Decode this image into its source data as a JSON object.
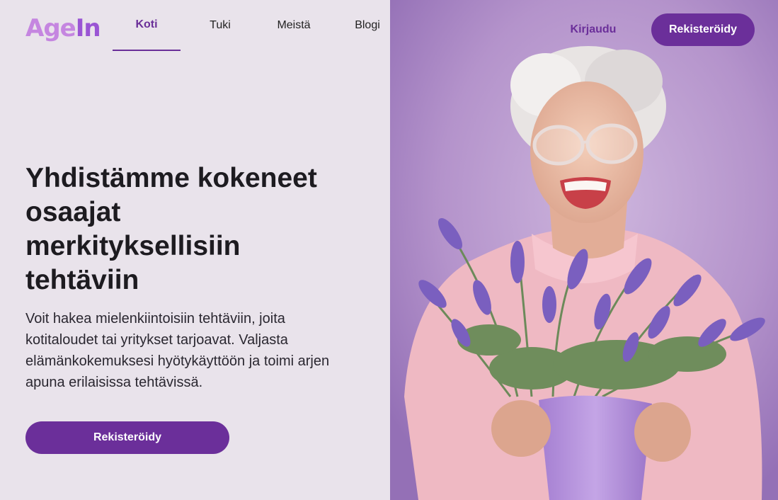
{
  "brand": {
    "logo_part1": "Age",
    "logo_part2": "In"
  },
  "nav": {
    "items": [
      {
        "label": "Koti",
        "active": true
      },
      {
        "label": "Tuki",
        "active": false
      },
      {
        "label": "Meistä",
        "active": false
      },
      {
        "label": "Blogi",
        "active": false
      }
    ]
  },
  "header": {
    "login_label": "Kirjaudu",
    "register_label": "Rekisteröidy"
  },
  "hero": {
    "headline": "Yhdistämme kokeneet osaajat merkityksellisiin tehtäviin",
    "description": "Voit hakea mielenkiintoisiin tehtäviin, joita kotitaloudet tai yritykset tarjoavat. Valjasta elämänkokemuksesi hyötykäyttöön ja toimi arjen apuna erilaisissa tehtävissä.",
    "cta_label": "Rekisteröidy"
  },
  "colors": {
    "primary": "#6b2f9a",
    "background": "#e9e3eb",
    "logo_light": "#c586e0",
    "logo_dark": "#9a55d4",
    "photo_bg": "#b596cc"
  }
}
